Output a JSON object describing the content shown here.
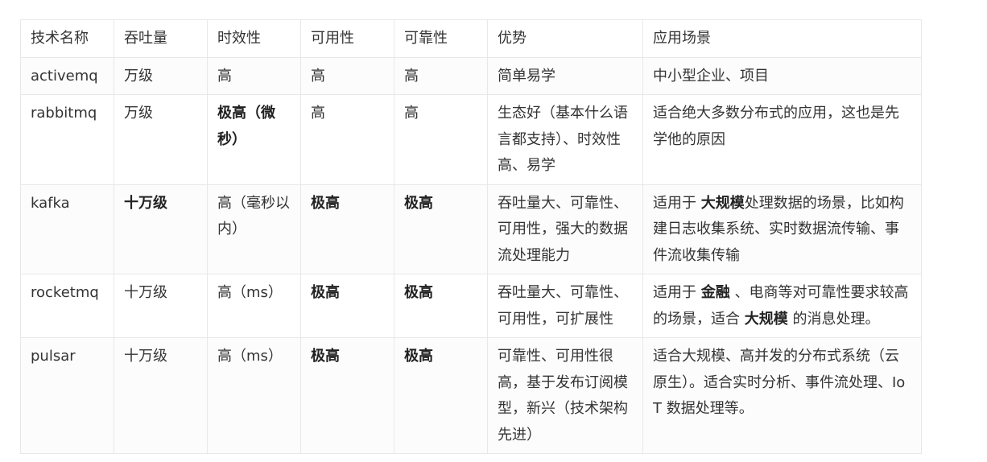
{
  "table": {
    "headers": [
      "技术名称",
      "吞吐量",
      "时效性",
      "可用性",
      "可靠性",
      "优势",
      "应用场景"
    ],
    "rows": [
      {
        "name": "activemq",
        "throughput": "万级",
        "timeliness": "高",
        "availability": "高",
        "reliability": "高",
        "advantage": "简单易学",
        "scenario": {
          "p1": "中小型企业、项目"
        }
      },
      {
        "name": "rabbitmq",
        "throughput": "万级",
        "timeliness": "极高（微秒）",
        "availability": "高",
        "reliability": "高",
        "advantage": "生态好（基本什么语言都支持）、时效性高、易学",
        "scenario": {
          "p1": "适合绝大多数分布式的应用，这也是先学他的原因"
        }
      },
      {
        "name": "kafka",
        "throughput": "十万级",
        "timeliness": "高（毫秒以内）",
        "availability": "极高",
        "reliability": "极高",
        "advantage": "吞吐量大、可靠性、可用性，强大的数据流处理能力",
        "scenario": {
          "p1": "适用于 ",
          "b1": "大规模",
          "p2": "处理数据的场景，比如构建日志收集系统、实时数据流传输、事件流收集传输"
        }
      },
      {
        "name": "rocketmq",
        "throughput": "十万级",
        "timeliness": "高（ms）",
        "availability": "极高",
        "reliability": "极高",
        "advantage": "吞吐量大、可靠性、可用性，可扩展性",
        "scenario": {
          "p1": "适用于 ",
          "b1": "金融",
          "p2": " 、电商等对可靠性要求较高的场景，适合 ",
          "b2": "大规模",
          "p3": " 的消息处理。"
        }
      },
      {
        "name": "pulsar",
        "throughput": "十万级",
        "timeliness": "高（ms）",
        "availability": "极高",
        "reliability": "极高",
        "advantage": "可靠性、可用性很高，基于发布订阅模型，新兴（技术架构先进）",
        "scenario": {
          "p1": "适合大规模、高并发的分布式系统（云原生）。适合实时分析、事件流处理、IoT 数据处理等。"
        }
      }
    ]
  }
}
